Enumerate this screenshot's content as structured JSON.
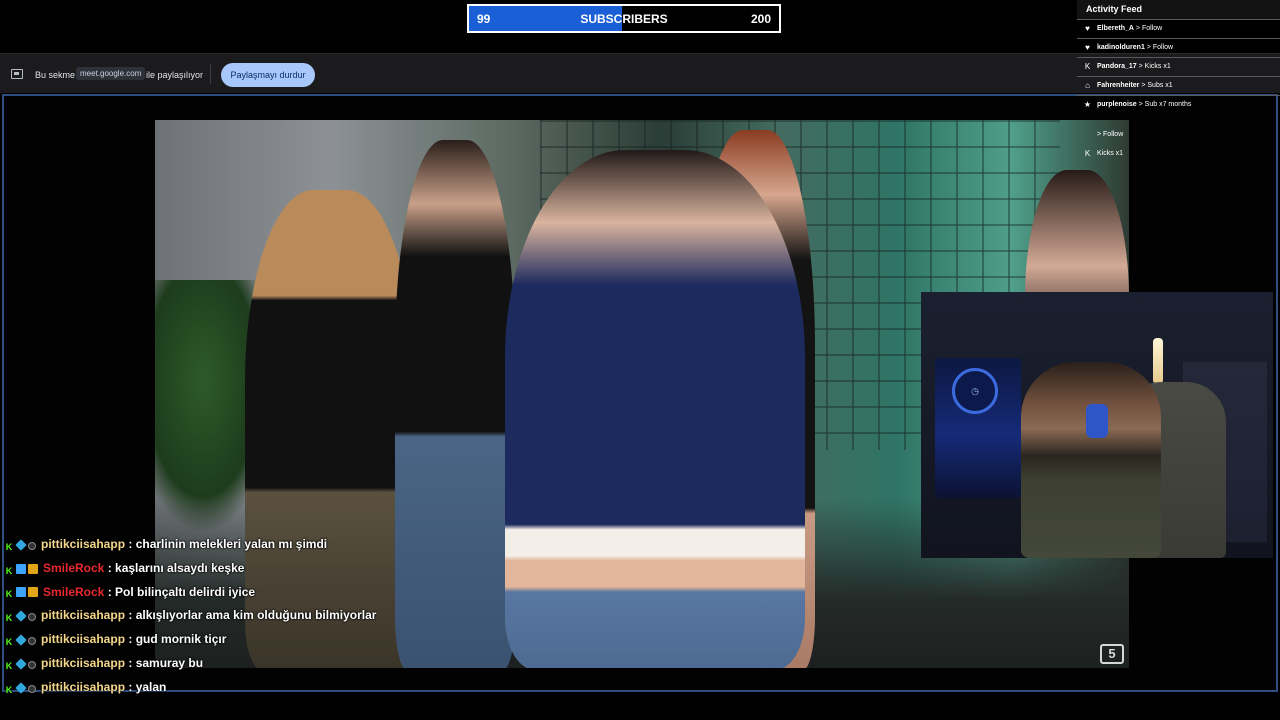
{
  "subscriber_goal": {
    "current": "99",
    "label": "SUBSCRIBERS",
    "target": "200",
    "progress_fraction": 0.495,
    "fill_color": "#1a5fd6"
  },
  "sharing_bar": {
    "pre_text": "Bu sekme",
    "domain": "meet.google.com",
    "post_text": "ile paylaşılıyor",
    "stop_button": "Paylaşmayı durdur",
    "icon": "screen-share-icon"
  },
  "activity_feed": {
    "title": "Activity Feed",
    "items": [
      {
        "icon": "heart-icon",
        "name": "Elbereth_A",
        "action": "> Follow"
      },
      {
        "icon": "heart-icon",
        "name": "kadinolduren1",
        "action": "> Follow"
      },
      {
        "icon": "kick-icon",
        "name": "Pandora_17",
        "action": "> Kicks x1"
      },
      {
        "icon": "gift-icon",
        "name": "Fahrenheiter",
        "action": "> Subs x1"
      },
      {
        "icon": "star-icon",
        "name": "purplenoise",
        "action": "> Sub x7 months"
      },
      {
        "icon": "",
        "name": "",
        "action": "> Follow"
      },
      {
        "icon": "kick-icon",
        "name": "",
        "action": "Kicks x1"
      }
    ]
  },
  "video": {
    "channel_logo": "5"
  },
  "chat": [
    {
      "user": "pittikciisahapp",
      "color": "gold",
      "text": ": charlinin melekleri yalan mı şimdi"
    },
    {
      "user": "SmileRock",
      "color": "red",
      "text": ": kaşlarını alsaydı keşke"
    },
    {
      "user": "SmileRock",
      "color": "red",
      "text": ": Pol bilinçaltı delirdi iyice"
    },
    {
      "user": "pittikciisahapp",
      "color": "gold",
      "text": ": alkışlıyorlar ama kim olduğunu bilmiyorlar"
    },
    {
      "user": "pittikciisahapp",
      "color": "gold",
      "text": ": gud mornik tiçır"
    },
    {
      "user": "pittikciisahapp",
      "color": "gold",
      "text": ": samuray bu"
    },
    {
      "user": "pittikciisahapp",
      "color": "gold",
      "text": ": yalan"
    }
  ]
}
